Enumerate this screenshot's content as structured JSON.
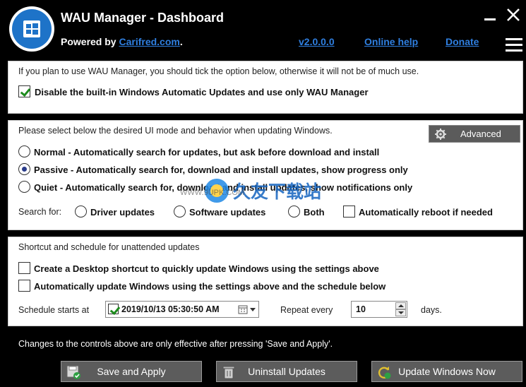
{
  "header": {
    "title": "WAU Manager - Dashboard",
    "powered_prefix": "Powered by ",
    "powered_link": "Carifred.com",
    "powered_suffix": ".",
    "version_link": "v2.0.0.0",
    "help_link": "Online help",
    "donate_link": "Donate"
  },
  "panel1": {
    "info": "If you plan to use WAU Manager, you should tick the option below, otherwise it will not be of much use.",
    "disable_label": "Disable the built-in Windows Automatic Updates and use only WAU Manager",
    "disable_checked": true
  },
  "panel2": {
    "info": "Please select below the desired UI mode and behavior when updating Windows.",
    "advanced_label": "Advanced",
    "normal_label": "Normal - Automatically search for updates, but ask before download and install",
    "passive_label": "Passive - Automatically search for, download and install updates, show progress only",
    "quiet_label": "Quiet - Automatically search for, download and install updates, show notifications only",
    "selected_mode": "Passive",
    "search_for_label": "Search for:",
    "driver_label": "Driver updates",
    "software_label": "Software updates",
    "both_label": "Both",
    "reboot_label": "Automatically reboot if needed"
  },
  "panel3": {
    "info": "Shortcut and schedule for unattended updates",
    "shortcut_label": "Create a Desktop shortcut to quickly update Windows using the settings above",
    "schedule_label": "Automatically update Windows using the settings above and the schedule below",
    "schedule_starts_label": "Schedule starts at",
    "date_value": "2019/10/13  05:30:50 AM",
    "date_checked": true,
    "repeat_label": "Repeat every",
    "repeat_value": "10",
    "days_label": "days."
  },
  "footer": {
    "notice": "Changes to the controls above are only effective after pressing 'Save and Apply'.",
    "save_label": "Save and Apply",
    "uninstall_label": "Uninstall Updates",
    "update_label": "Update Windows Now"
  },
  "watermark": {
    "brand": "久友下载站",
    "url": "WWW.9UPK.COM"
  },
  "colors": {
    "link": "#2f7fe0",
    "logo_blue": "#1e73c8",
    "check_green": "#1c8a1c",
    "button_gray": "#5c5c5c"
  }
}
